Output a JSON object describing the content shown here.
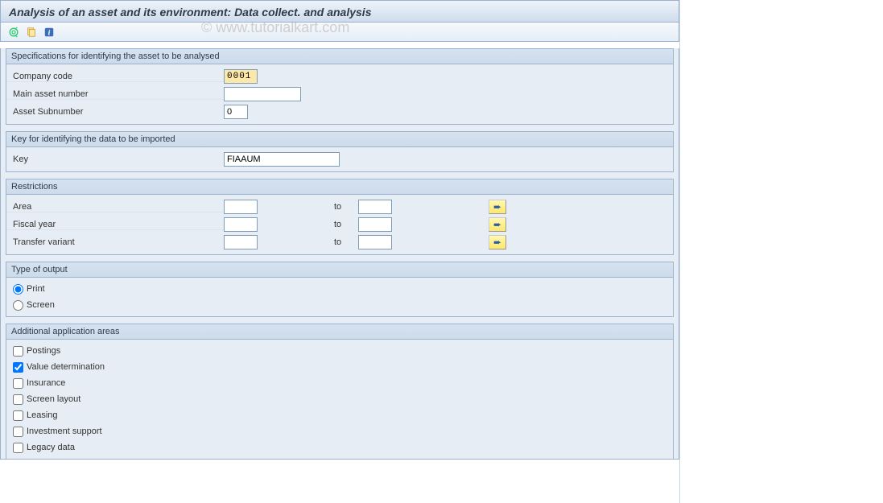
{
  "title": "Analysis of an asset and its environment: Data collect. and analysis",
  "watermark": "© www.tutorialkart.com",
  "toolbar": {
    "icons": [
      "execute-icon",
      "variant-icon",
      "info-icon"
    ]
  },
  "group_spec": {
    "caption": "Specifications for identifying the asset to be analysed",
    "company_code_label": "Company code",
    "company_code_value": "0001",
    "main_asset_label": "Main asset number",
    "main_asset_value": "",
    "asset_sub_label": "Asset Subnumber",
    "asset_sub_value": "0"
  },
  "group_key": {
    "caption": "Key for identifying the data to be imported",
    "key_label": "Key",
    "key_value": "FIAAUM"
  },
  "group_restrict": {
    "caption": "Restrictions",
    "to_label": "to",
    "rows": [
      {
        "label": "Area",
        "from": "",
        "to": ""
      },
      {
        "label": "Fiscal year",
        "from": "",
        "to": ""
      },
      {
        "label": "Transfer variant",
        "from": "",
        "to": ""
      }
    ]
  },
  "group_output": {
    "caption": "Type of output",
    "print_label": "Print",
    "print_selected": true,
    "screen_label": "Screen",
    "screen_selected": false
  },
  "group_addl": {
    "caption": "Additional application areas",
    "items": [
      {
        "label": "Postings",
        "checked": false
      },
      {
        "label": "Value determination",
        "checked": true
      },
      {
        "label": "Insurance",
        "checked": false
      },
      {
        "label": "Screen layout",
        "checked": false
      },
      {
        "label": "Leasing",
        "checked": false
      },
      {
        "label": "Investment support",
        "checked": false
      },
      {
        "label": "Legacy data",
        "checked": false
      }
    ]
  }
}
